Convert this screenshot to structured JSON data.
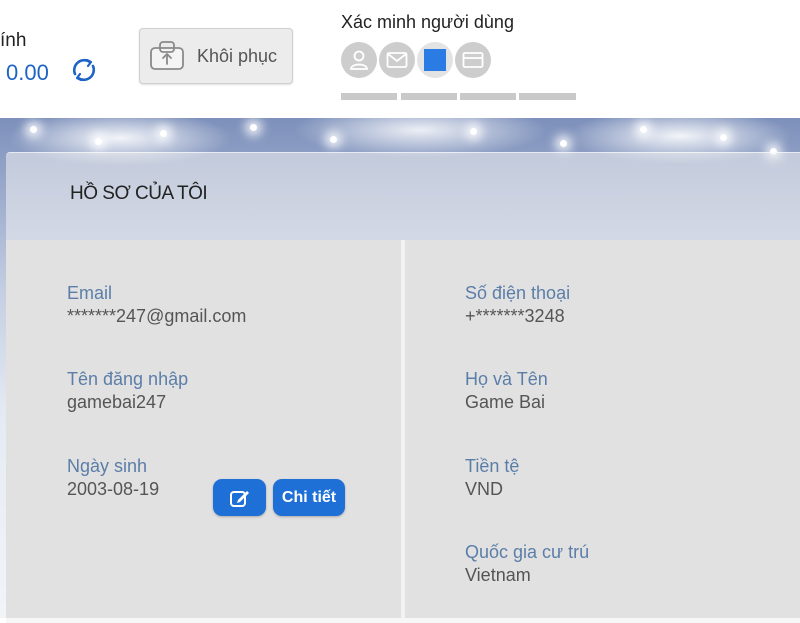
{
  "balance": {
    "label_fragment": "ính",
    "value": "0.00"
  },
  "restore": {
    "label": "Khôi phục"
  },
  "verification": {
    "title": "Xác minh người dùng",
    "icons": [
      "user-icon",
      "mail-icon",
      "phone-icon",
      "card-icon"
    ],
    "active_color": "#2a7be4"
  },
  "profile": {
    "title": "HỒ SƠ CỦA TÔI",
    "left_fields": [
      {
        "label": "Email",
        "value": "*******247@gmail.com"
      },
      {
        "label": "Tên đăng nhập",
        "value": "gamebai247"
      },
      {
        "label": "Ngày sinh",
        "value": "2003-08-19"
      }
    ],
    "right_fields": [
      {
        "label": "Số điện thoại",
        "value": "+*******3248"
      },
      {
        "label": "Họ và Tên",
        "value": "Game Bai"
      },
      {
        "label": "Tiền tệ",
        "value": "VND"
      },
      {
        "label": "Quốc gia cư trú",
        "value": "Vietnam"
      }
    ],
    "detail_button": "Chi tiết"
  },
  "colors": {
    "accent": "#1e6fd6",
    "label": "#5b7ea8",
    "balance": "#1e63c6"
  }
}
